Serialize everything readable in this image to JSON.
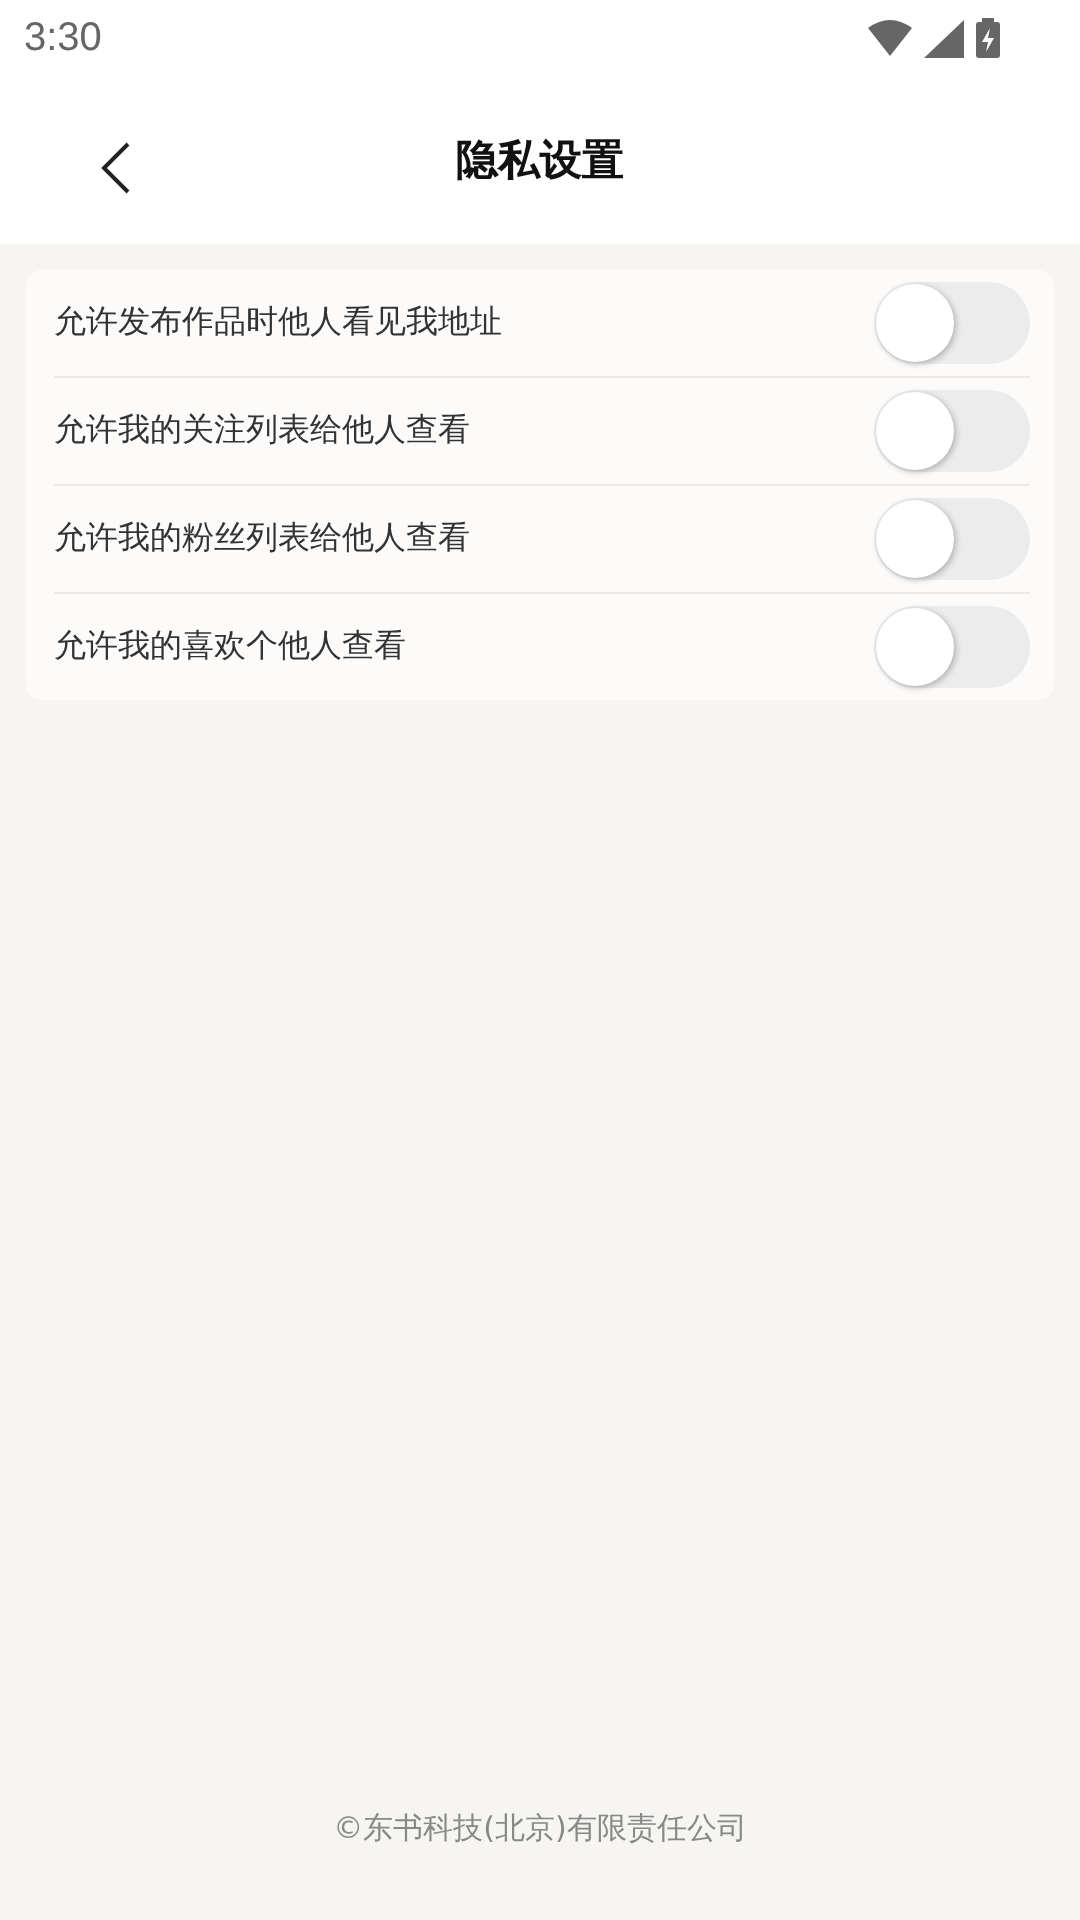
{
  "status_bar": {
    "time": "3:30"
  },
  "header": {
    "title": "隐私设置"
  },
  "settings": [
    {
      "label": "允许发布作品时他人看见我地址",
      "on": false
    },
    {
      "label": "允许我的关注列表给他人查看",
      "on": false
    },
    {
      "label": "允许我的粉丝列表给他人查看",
      "on": false
    },
    {
      "label": "允许我的喜欢个他人查看",
      "on": false
    }
  ],
  "footer": {
    "copyright": "©东书科技(北京)有限责任公司"
  }
}
